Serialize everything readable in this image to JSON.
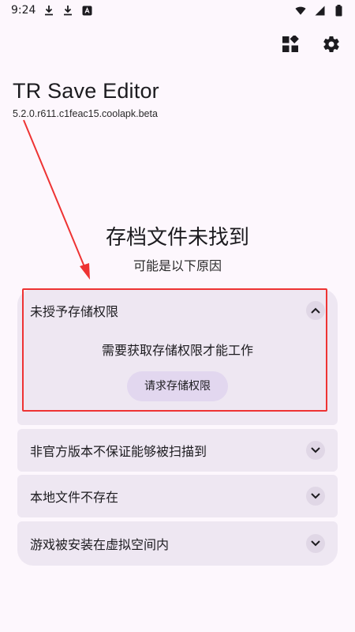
{
  "status_bar": {
    "time": "9:24"
  },
  "app": {
    "title": "TR Save Editor",
    "version": "5.2.0.r611.c1feac15.coolapk.beta"
  },
  "icons": {
    "widgets": "widgets-icon",
    "settings": "gear-icon",
    "expand_less": "chevron-up-icon",
    "expand_more": "chevron-down-icon"
  },
  "main": {
    "headline": "存档文件未找到",
    "subheadline": "可能是以下原因"
  },
  "reasons": [
    {
      "title": "未授予存储权限",
      "expanded": true,
      "body": "需要获取存储权限才能工作",
      "action_label": "请求存储权限"
    },
    {
      "title": "非官方版本不保证能够被扫描到",
      "expanded": false
    },
    {
      "title": "本地文件不存在",
      "expanded": false
    },
    {
      "title": "游戏被安装在虚拟空间内",
      "expanded": false
    }
  ],
  "colors": {
    "background": "#fdf7fd",
    "card": "#eee7f2",
    "button": "#e2d7ef",
    "annotation": "#ee3333"
  }
}
